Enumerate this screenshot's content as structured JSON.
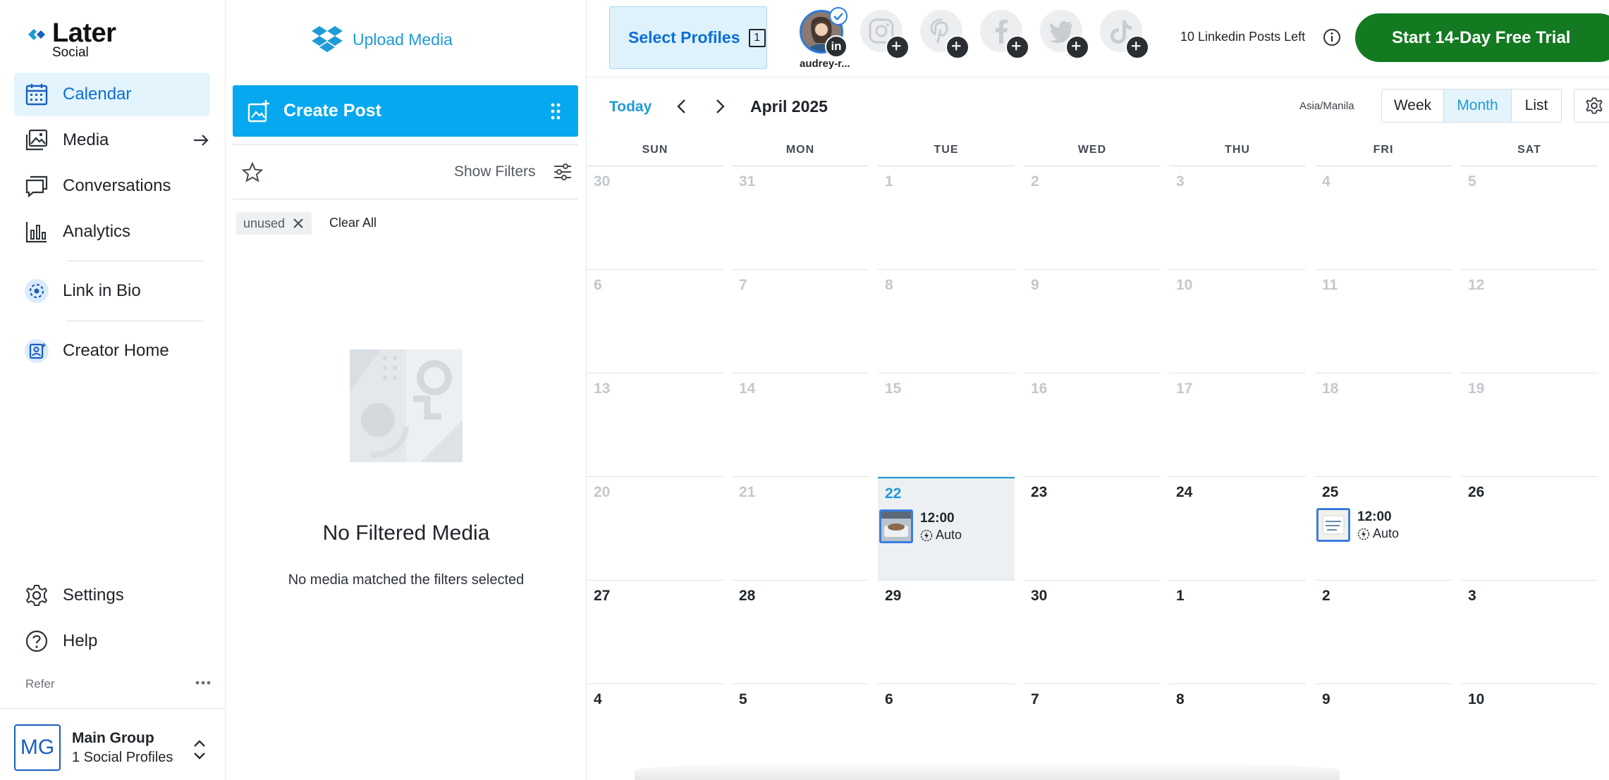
{
  "nav": {
    "logo_word": "Later",
    "logo_sub": "Social",
    "items": [
      {
        "label": "Calendar"
      },
      {
        "label": "Media"
      },
      {
        "label": "Conversations"
      },
      {
        "label": "Analytics"
      },
      {
        "label": "Link in Bio"
      },
      {
        "label": "Creator Home"
      },
      {
        "label": "Settings"
      },
      {
        "label": "Help"
      }
    ],
    "refer": "Refer",
    "group": {
      "initials": "MG",
      "name": "Main Group",
      "profiles": "1 Social Profiles"
    }
  },
  "media_panel": {
    "upload_label": "Upload Media",
    "create_post_label": "Create Post",
    "show_filters_label": "Show Filters",
    "chip_label": "unused",
    "clear_all_label": "Clear All",
    "empty_title": "No Filtered Media",
    "empty_subtitle": "No media matched the filters selected"
  },
  "topbar": {
    "select_profiles_label": "Select Profiles",
    "select_profiles_count": "1",
    "active_profile_name": "audrey-r...",
    "active_profile_badge": "in",
    "posts_left": "10 Linkedin Posts Left",
    "trial_label": "Start 14-Day Free Trial"
  },
  "calendar": {
    "today_label": "Today",
    "month_title": "April 2025",
    "timezone": "Asia/Manila",
    "views": [
      "Week",
      "Month",
      "List"
    ],
    "active_view": "Month",
    "weekdays": [
      "SUN",
      "MON",
      "TUE",
      "WED",
      "THU",
      "FRI",
      "SAT"
    ],
    "weeks": [
      [
        "30",
        "31",
        "1",
        "2",
        "3",
        "4",
        "5"
      ],
      [
        "6",
        "7",
        "8",
        "9",
        "10",
        "11",
        "12"
      ],
      [
        "13",
        "14",
        "15",
        "16",
        "17",
        "18",
        "19"
      ],
      [
        "20",
        "21",
        "22",
        "23",
        "24",
        "25",
        "26"
      ],
      [
        "27",
        "28",
        "29",
        "30",
        "1",
        "2",
        "3"
      ],
      [
        "4",
        "5",
        "6",
        "7",
        "8",
        "9",
        "10"
      ]
    ],
    "today": "22",
    "posts": [
      {
        "day": "22",
        "time": "12:00",
        "mode": "Auto"
      },
      {
        "day": "25",
        "time": "12:00",
        "mode": "Auto"
      }
    ]
  },
  "colors": {
    "accent": "#06a8ef",
    "link": "#1e9bd7",
    "trial": "#137a22",
    "active_nav_bg": "#e3f4fd"
  }
}
